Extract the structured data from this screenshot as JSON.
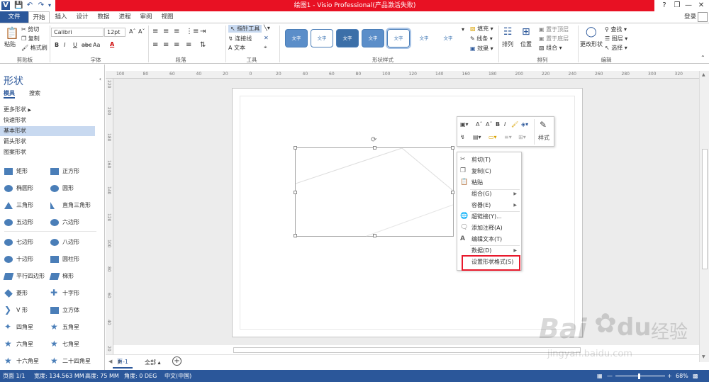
{
  "title_bar": {
    "title": "绘图1 - Visio Professional(产品激活失败)",
    "help": "?"
  },
  "tabs": [
    {
      "label": "文件"
    },
    {
      "label": "开始"
    },
    {
      "label": "插入"
    },
    {
      "label": "设计"
    },
    {
      "label": "数据"
    },
    {
      "label": "进程"
    },
    {
      "label": "审阅"
    },
    {
      "label": "视图"
    }
  ],
  "login_label": "登录",
  "ribbon": {
    "clipboard": {
      "paste": "粘贴",
      "cut": "剪切",
      "copy": "复制",
      "format_painter": "格式刷",
      "group": "剪贴板"
    },
    "font": {
      "name": "Calibri",
      "size": "12pt",
      "group": "字体",
      "bold": "B",
      "italic": "I",
      "underline": "U",
      "strike": "abc",
      "case": "Aa",
      "color": "A"
    },
    "paragraph": {
      "group": "段落"
    },
    "tools": {
      "pointer": "指针工具",
      "connector": "连接线",
      "text": "文本",
      "group": "工具"
    },
    "shape_styles": {
      "group": "形状样式",
      "items": [
        "文字",
        "文字",
        "文字",
        "文字",
        "文字",
        "文字",
        "文字"
      ],
      "fill": "填充",
      "line": "线条",
      "effect": "效果"
    },
    "arrange": {
      "group": "排列",
      "arrange": "排列",
      "position": "位置",
      "bring_front": "置于顶层",
      "send_back": "置于底层",
      "group_btn": "组合"
    },
    "edit": {
      "group": "编辑",
      "change_shape": "更改形状",
      "find": "查找",
      "layer": "图层",
      "select": "选择"
    }
  },
  "shapes_panel": {
    "title": "形状",
    "tabs": [
      "模具",
      "搜索"
    ],
    "nav": [
      "更多形状",
      "快速形状",
      "基本形状",
      "箭头形状",
      "图案形状"
    ],
    "selected_nav": "基本形状",
    "shapes": [
      [
        "矩形",
        "正方形"
      ],
      [
        "椭圆形",
        "圆形"
      ],
      [
        "三角形",
        "直角三角形"
      ],
      [
        "五边形",
        "六边形"
      ],
      [
        "七边形",
        "八边形"
      ],
      [
        "十边形",
        "圆柱形"
      ],
      [
        "平行四边形",
        "梯形"
      ],
      [
        "菱形",
        "十字形"
      ],
      [
        "V 形",
        "立方体"
      ],
      [
        "四角星",
        "五角星"
      ],
      [
        "六角星",
        "七角星"
      ],
      [
        "十六角星",
        "二十四角星"
      ]
    ]
  },
  "ruler_h": [
    "100",
    "80",
    "60",
    "40",
    "20",
    "0",
    "20",
    "40",
    "60",
    "80",
    "100",
    "120",
    "140",
    "160",
    "180",
    "200",
    "220",
    "240",
    "260",
    "280",
    "300",
    "320"
  ],
  "ruler_v": [
    "220",
    "200",
    "180",
    "160",
    "140",
    "120",
    "100",
    "80",
    "60",
    "40",
    "20"
  ],
  "mini_toolbar": {
    "style_label": "样式"
  },
  "context_menu": {
    "cut": "剪切(T)",
    "copy": "复制(C)",
    "paste": "粘贴",
    "group": "组合(G)",
    "container": "容器(E)",
    "hyperlink": "超链接(Y)...",
    "comment": "添加注释(A)",
    "edit_text": "编辑文本(T)",
    "data": "数据(D)",
    "format_shape": "设置形状格式(S)"
  },
  "page_tabs": {
    "page": "页-1",
    "all": "全部",
    "add": "+"
  },
  "status": {
    "page": "页面 1/1",
    "width": "宽度: 134.563 MM",
    "height": "高度: 75 MM",
    "angle": "角度: 0 DEG",
    "lang": "中文(中国)",
    "zoom": "68%"
  },
  "watermark": {
    "brand": "Bai",
    "suffix": "经验",
    "url": "jingyan.baidu.com"
  }
}
